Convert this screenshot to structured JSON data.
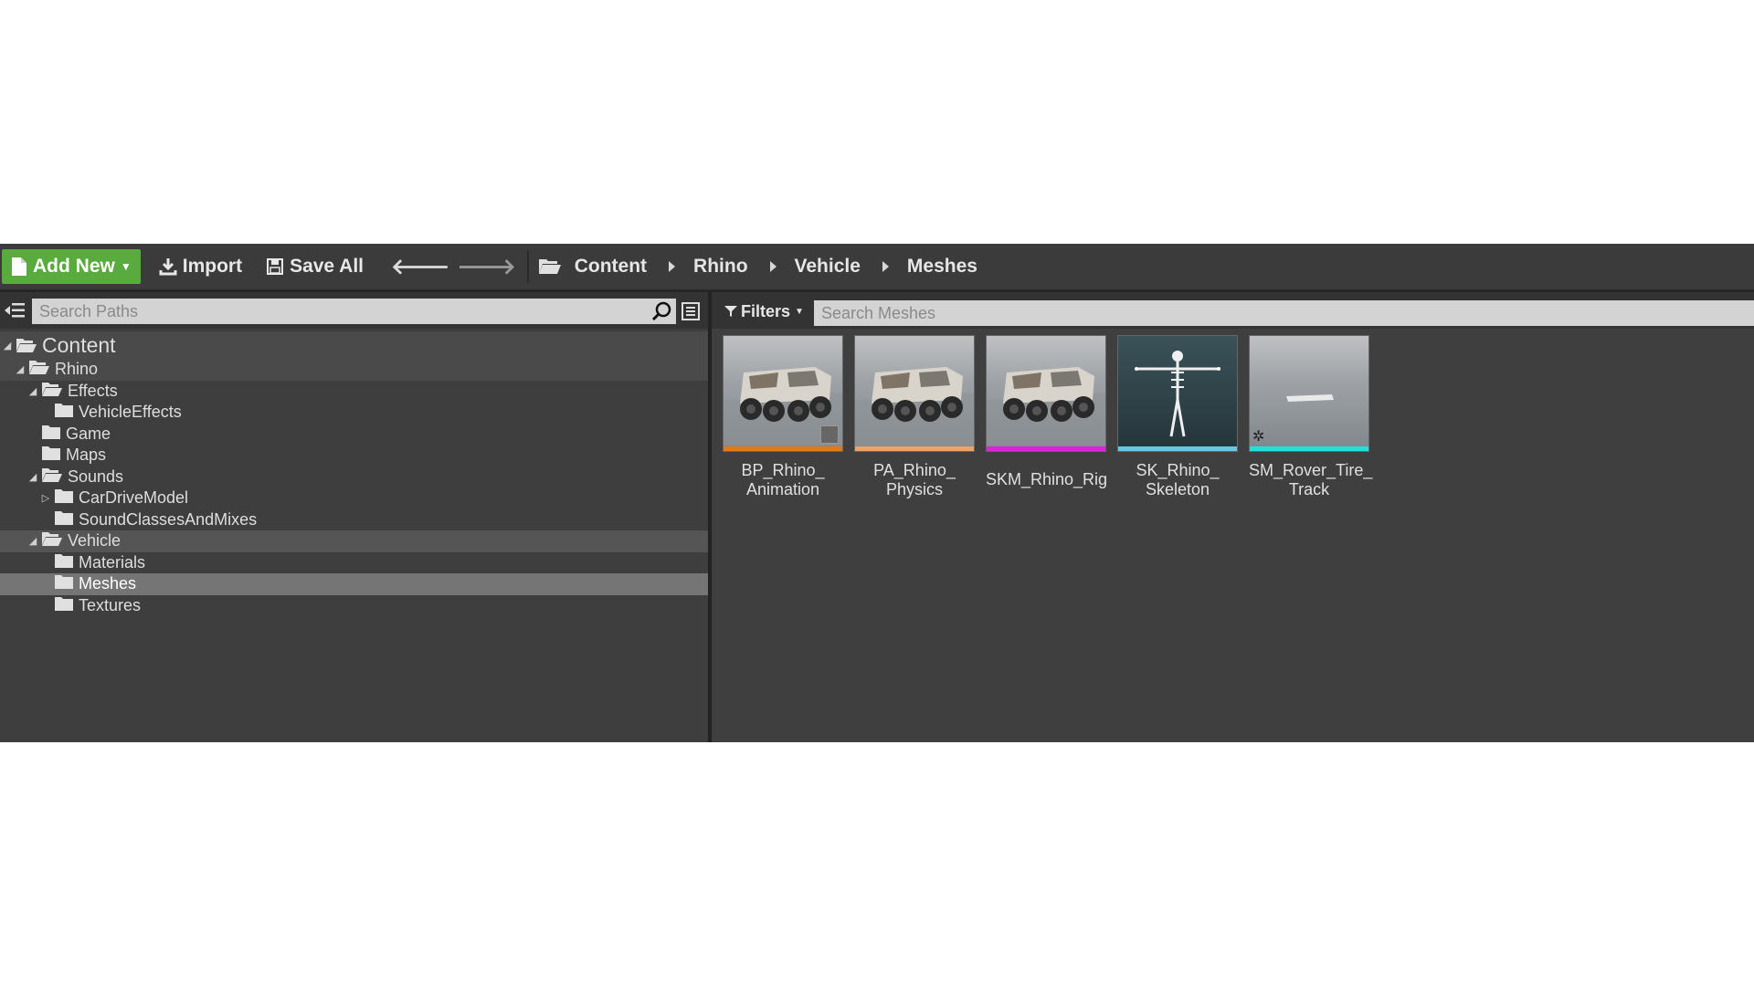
{
  "toolbar": {
    "add_new_label": "Add New",
    "import_label": "Import",
    "save_all_label": "Save All",
    "breadcrumbs": [
      "Content",
      "Rhino",
      "Vehicle",
      "Meshes"
    ]
  },
  "sources": {
    "search_placeholder": "Search Paths",
    "tree": [
      {
        "label": "Content",
        "depth": 0,
        "expanded": true
      },
      {
        "label": "Rhino",
        "depth": 1,
        "expanded": true
      },
      {
        "label": "Effects",
        "depth": 2,
        "expanded": true
      },
      {
        "label": "VehicleEffects",
        "depth": 3
      },
      {
        "label": "Game",
        "depth": 2
      },
      {
        "label": "Maps",
        "depth": 2
      },
      {
        "label": "Sounds",
        "depth": 2,
        "expanded": true
      },
      {
        "label": "CarDriveModel",
        "depth": 3,
        "collapsed": true
      },
      {
        "label": "SoundClassesAndMixes",
        "depth": 3
      },
      {
        "label": "Vehicle",
        "depth": 2,
        "expanded": true
      },
      {
        "label": "Materials",
        "depth": 3
      },
      {
        "label": "Meshes",
        "depth": 3,
        "selected": true
      },
      {
        "label": "Textures",
        "depth": 3
      }
    ]
  },
  "assets": {
    "filters_label": "Filters",
    "search_placeholder": "Search Meshes",
    "items": [
      {
        "label": "BP_Rhino_\nAnimation",
        "type_color": "#e07b12",
        "thumb": "vehicle"
      },
      {
        "label": "PA_Rhino_\nPhysics",
        "type_color": "#e8a46a",
        "thumb": "vehicle"
      },
      {
        "label": "SKM_Rhino_Rig",
        "type_color": "#e021e0",
        "thumb": "vehicle"
      },
      {
        "label": "SK_Rhino_\nSkeleton",
        "type_color": "#6bc6e6",
        "thumb": "skeleton"
      },
      {
        "label": "SM_Rover_Tire_\nTrack",
        "type_color": "#21e0e0",
        "thumb": "mesh"
      }
    ]
  }
}
